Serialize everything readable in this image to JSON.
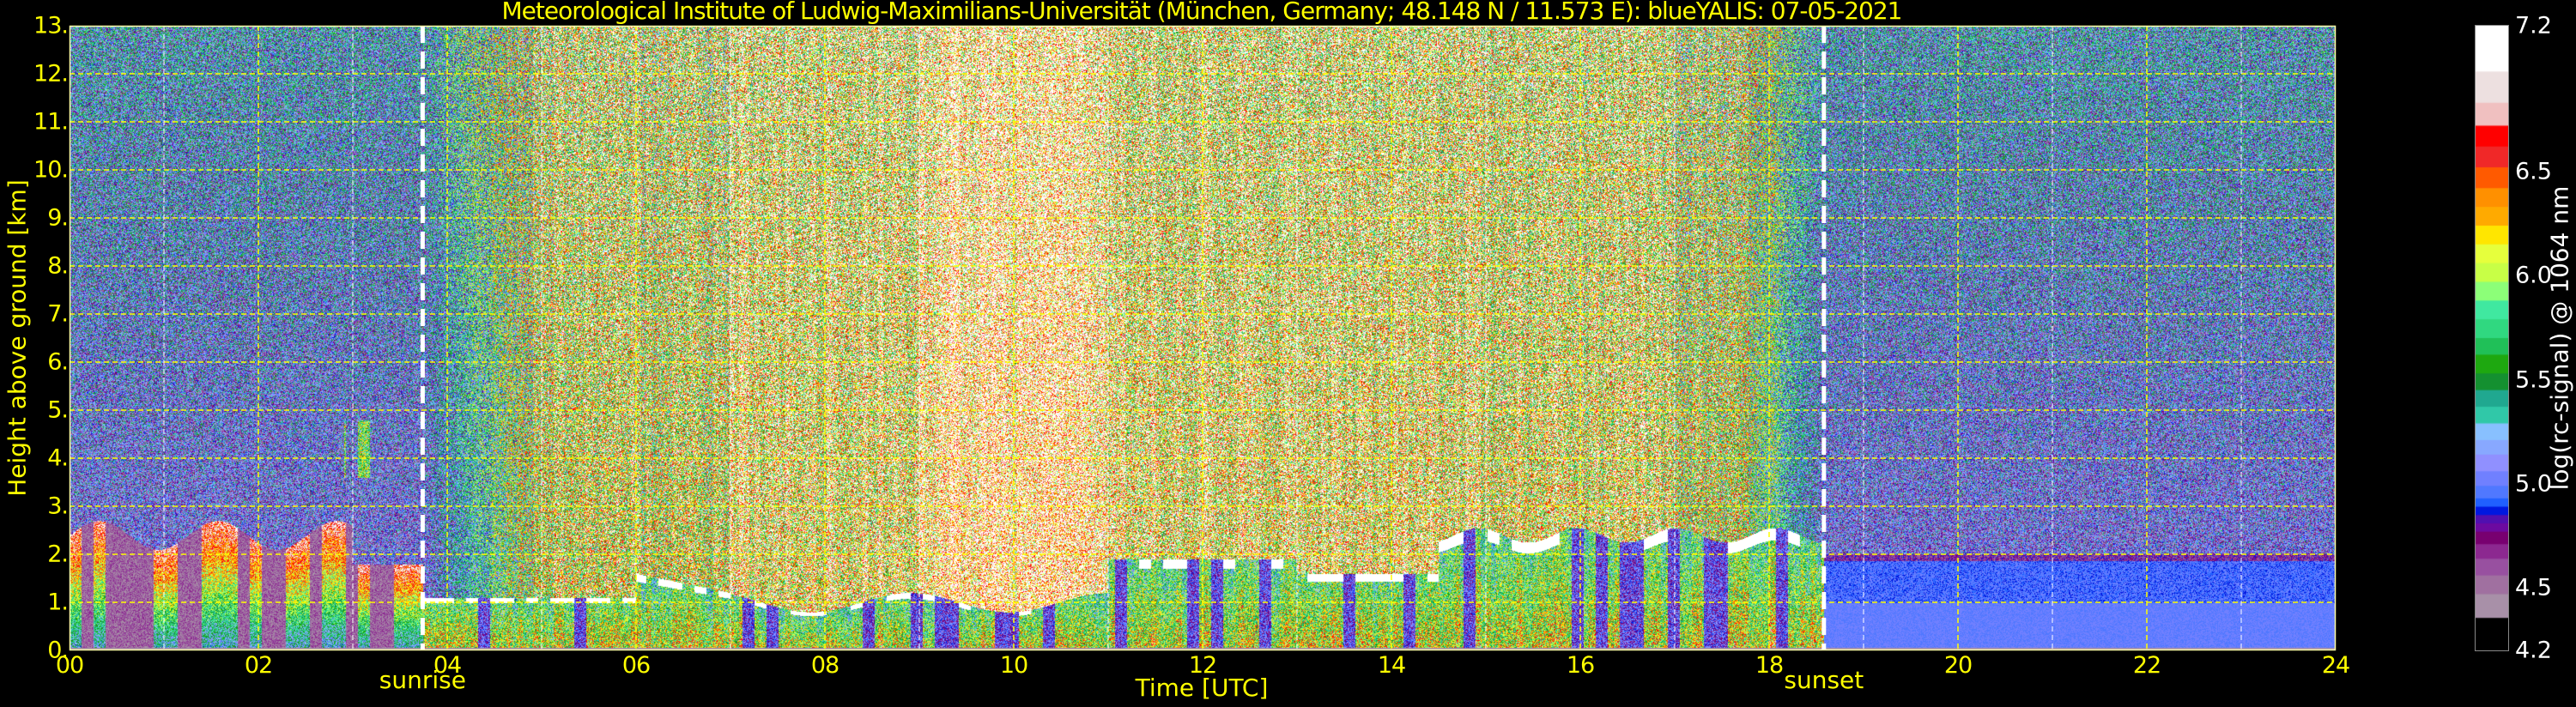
{
  "chart_data": {
    "type": "heatmap",
    "title": "Meteorological Institute of Ludwig-Maximilians-Universität (München, Germany; 48.148 N / 11.573 E):     blueYALIS: 07-05-2021",
    "xlabel": "Time [UTC]",
    "ylabel": "Height above ground [km]",
    "xlim": [
      0,
      24
    ],
    "ylim": [
      0,
      13
    ],
    "x_ticks": [
      0,
      2,
      4,
      6,
      8,
      10,
      12,
      14,
      16,
      18,
      20,
      22,
      24
    ],
    "x_tick_labels": [
      "00",
      "02",
      "04",
      "06",
      "08",
      "10",
      "12",
      "14",
      "16",
      "18",
      "20",
      "22",
      "24"
    ],
    "y_ticks": [
      0,
      1,
      2,
      3,
      4,
      5,
      6,
      7,
      8,
      9,
      10,
      11,
      12,
      13
    ],
    "y_tick_labels": [
      "0.",
      "1.",
      "2.",
      "3.",
      "4.",
      "5.",
      "6.",
      "7.",
      "8.",
      "9.",
      "10.",
      "11.",
      "12.",
      "13."
    ],
    "grid": true,
    "annotations": [
      {
        "label": "sunrise",
        "time": 3.74
      },
      {
        "label": "sunset",
        "time": 18.58
      }
    ],
    "colorbar": {
      "label": "log(rc-signal) @ 1064 nm",
      "range": [
        4.2,
        7.2
      ],
      "ticks": [
        7.2,
        6.5,
        6.0,
        5.5,
        5.0,
        4.5,
        4.2
      ],
      "tick_labels": [
        "7.2",
        "6.5",
        "6.0",
        "5.5",
        "5.0",
        "4.5",
        "4.2"
      ],
      "bounds": [
        7.2,
        6.98,
        6.83,
        6.72,
        6.62,
        6.52,
        6.42,
        6.33,
        6.24,
        6.15,
        6.06,
        5.97,
        5.88,
        5.79,
        5.7,
        5.62,
        5.53,
        5.45,
        5.37,
        5.29,
        5.21,
        5.14,
        5.06,
        4.99,
        4.93,
        4.89,
        4.85,
        4.81,
        4.77,
        4.71,
        4.64,
        4.56,
        4.47,
        4.36,
        4.2
      ],
      "colors": [
        "#ffffff",
        "#ede0e0",
        "#f0c0c0",
        "#ff0000",
        "#f02828",
        "#ff5a00",
        "#ff9000",
        "#ffaa00",
        "#ffe600",
        "#e6ff3c",
        "#c8ff46",
        "#8cff78",
        "#40e8a0",
        "#30d880",
        "#20c058",
        "#1ea810",
        "#149030",
        "#20a890",
        "#30c8a8",
        "#88c0ff",
        "#88a8ff",
        "#9090ff",
        "#7080ff",
        "#5078ff",
        "#2060ff",
        "#0018e0",
        "#5010b0",
        "#6c0aa0",
        "#780070",
        "#8c2890",
        "#9850a0",
        "#a070a0",
        "#a890a8"
      ]
    }
  },
  "colors": {
    "axis_text": "#ffff00",
    "grid": "#ffff00",
    "colorbar_text": "#ffffff",
    "background": "#000000"
  }
}
